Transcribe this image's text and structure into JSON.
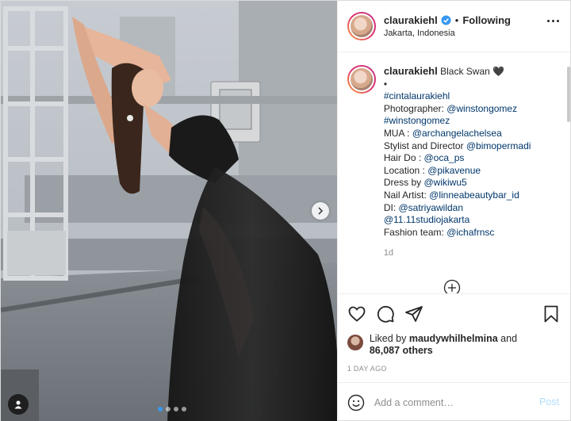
{
  "header": {
    "username": "claurakiehl",
    "separator": "•",
    "follow_status": "Following",
    "location": "Jakarta, Indonesia"
  },
  "caption": {
    "username": "claurakiehl",
    "lines": [
      {
        "text": "Black Swan 🖤",
        "type": "inline"
      },
      {
        "text": "•",
        "type": "plain"
      },
      {
        "text": "#cintalaurakiehl",
        "type": "link"
      },
      {
        "prefix": "Photographer: ",
        "link": "@winstongomez"
      },
      {
        "text": "#winstongomez",
        "type": "link"
      },
      {
        "prefix": "MUA : ",
        "link": "@archangelachelsea"
      },
      {
        "prefix": "Stylist and Director ",
        "link": "@bimopermadi"
      },
      {
        "prefix": "Hair Do : ",
        "link": "@oca_ps"
      },
      {
        "prefix": "Location : ",
        "link": "@pikavenue"
      },
      {
        "prefix": "Dress by ",
        "link": "@wikiwu5"
      },
      {
        "prefix": "Nail Artist: ",
        "link": "@linneabeautybar_id"
      },
      {
        "prefix": "DI: ",
        "link": "@satriyawildan"
      },
      {
        "text": "@11.11studiojakarta",
        "type": "link"
      },
      {
        "prefix": "Fashion team: ",
        "link": "@ichafrnsc"
      }
    ],
    "age": "1d"
  },
  "likes": {
    "prefix": "Liked by ",
    "user": "maudywhilhelmina",
    "and": " and",
    "count": "86,087 others"
  },
  "date": "1 DAY AGO",
  "comment_box": {
    "placeholder": "Add a comment…",
    "post_label": "Post"
  },
  "icons": {
    "verified": "verified-badge-icon",
    "more": "more-options-icon",
    "like": "heart-icon",
    "comment": "comment-icon",
    "share": "share-icon",
    "save": "bookmark-icon",
    "emoji": "emoji-icon",
    "load_more": "plus-circle-icon",
    "next": "chevron-right-icon",
    "tag": "user-tag-icon"
  },
  "colors": {
    "verified": "#3897f0",
    "link": "#00376b",
    "muted": "#8e8e8e",
    "post_disabled": "#b2dffc"
  },
  "carousel": {
    "slides": 4,
    "active": 1
  }
}
